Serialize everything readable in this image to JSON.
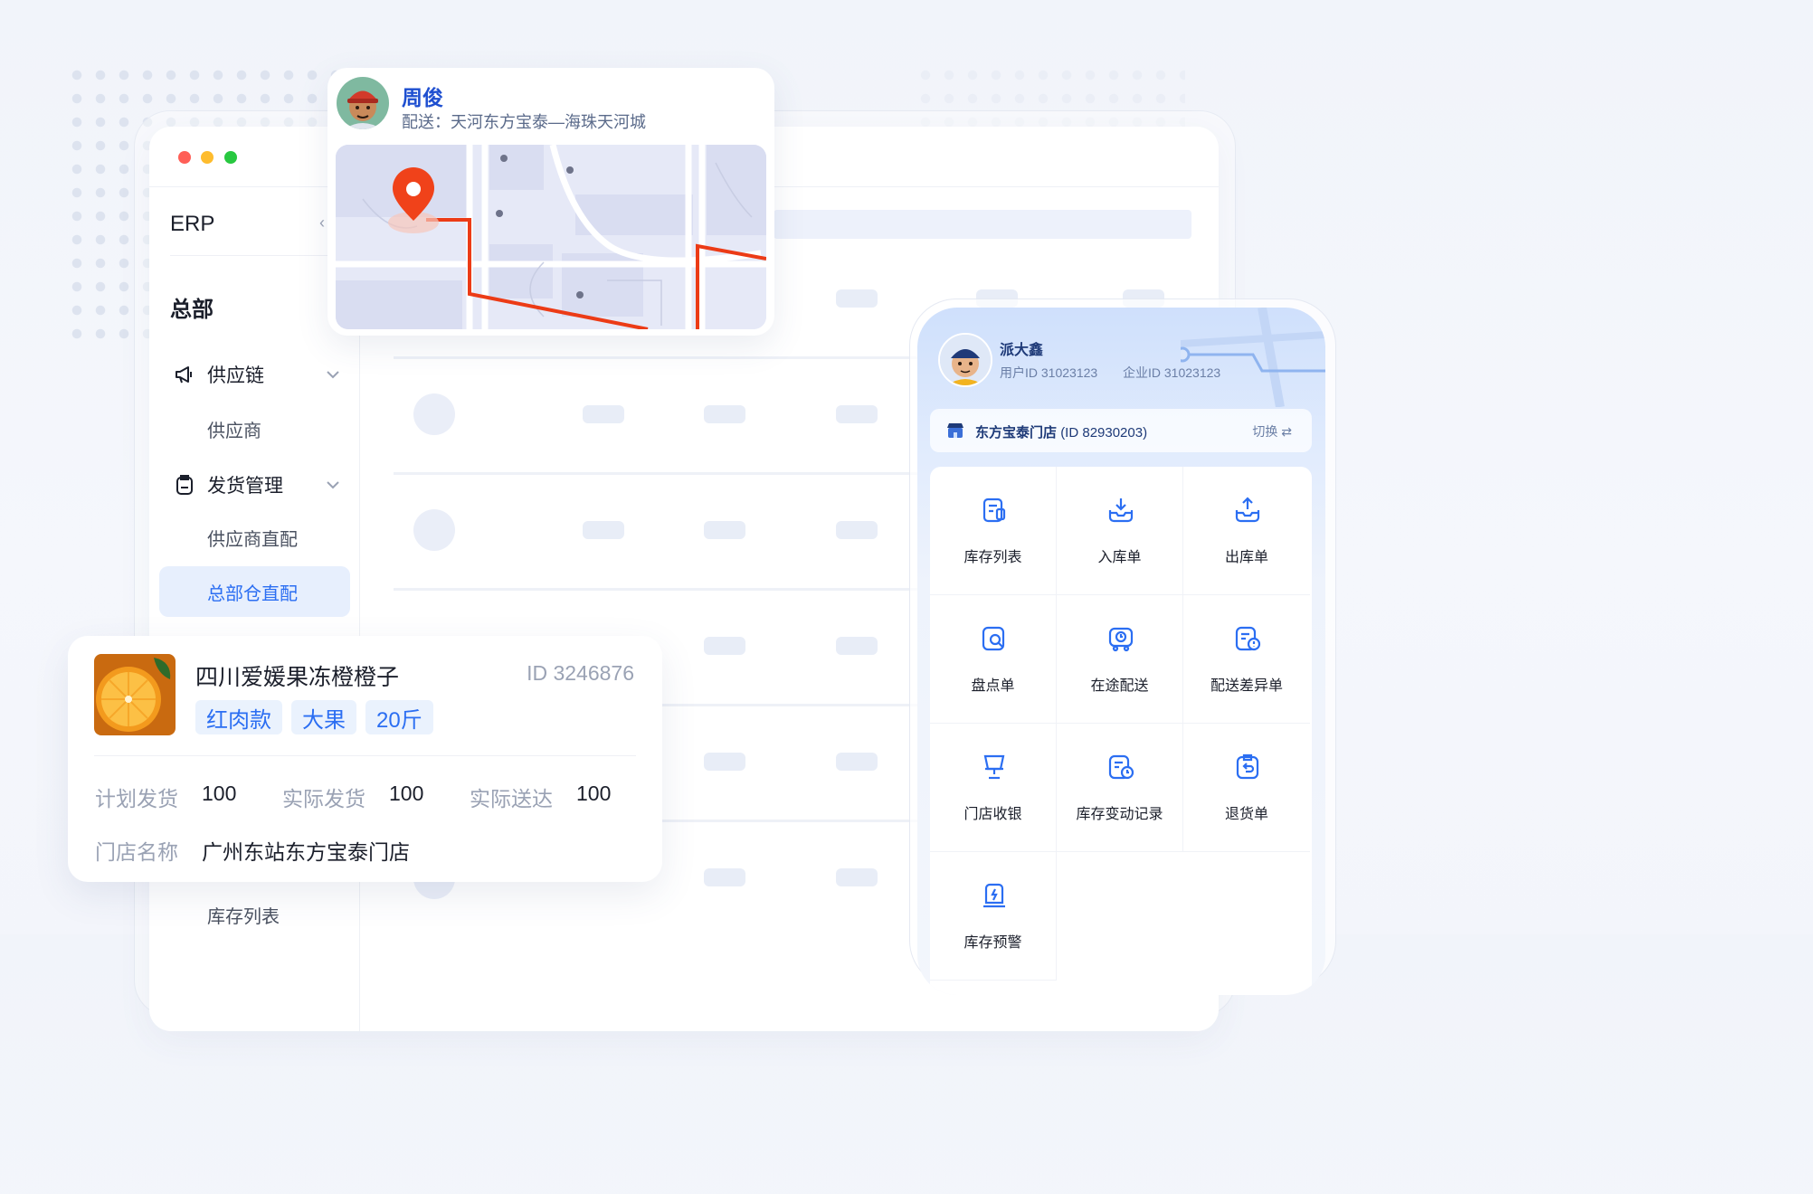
{
  "window": {
    "traffic_lights": [
      "#ff5f57",
      "#febc2e",
      "#28c840"
    ],
    "app_title": "ERP",
    "org": "总部",
    "nav": [
      {
        "label": "供应链",
        "icon": "megaphone-icon",
        "children": [
          "供应商"
        ]
      },
      {
        "label": "发货管理",
        "icon": "clipboard-icon",
        "children": [
          "供应商直配",
          "总部仓直配"
        ]
      }
    ],
    "active_item": "总部仓直配",
    "bottom_item": "库存列表"
  },
  "delivery_card": {
    "courier_name": "周俊",
    "route_label": "配送：",
    "route": "天河东方宝泰—海珠天河城"
  },
  "product_card": {
    "name": "四川爱媛果冻橙橙子",
    "id": "ID 3246876",
    "tags": [
      "红肉款",
      "大果",
      "20斤"
    ],
    "planned_label": "计划发货",
    "planned_value": "100",
    "actual_label": "实际发货",
    "actual_value": "100",
    "delivered_label": "实际送达",
    "delivered_value": "100",
    "store_label": "门店名称",
    "store_value": "广州东站东方宝泰门店"
  },
  "mobile": {
    "user_name": "派大鑫",
    "user_id": "用户ID 31023123",
    "company_id": "企业ID 31023123",
    "store_name": "东方宝泰门店",
    "store_id": "(ID 82930203)",
    "switch_label": "切换",
    "grid": [
      {
        "label": "库存列表",
        "icon": "inventory-list-icon"
      },
      {
        "label": "入库单",
        "icon": "inbound-icon"
      },
      {
        "label": "出库单",
        "icon": "outbound-icon"
      },
      {
        "label": "盘点单",
        "icon": "stocktake-icon"
      },
      {
        "label": "在途配送",
        "icon": "in-transit-icon"
      },
      {
        "label": "配送差异单",
        "icon": "delivery-discrepancy-icon"
      },
      {
        "label": "门店收银",
        "icon": "cashier-icon"
      },
      {
        "label": "库存变动记录",
        "icon": "inventory-change-icon"
      },
      {
        "label": "退货单",
        "icon": "return-icon"
      },
      {
        "label": "库存预警",
        "icon": "inventory-alert-icon"
      }
    ],
    "accent": "#2b6ef2"
  }
}
